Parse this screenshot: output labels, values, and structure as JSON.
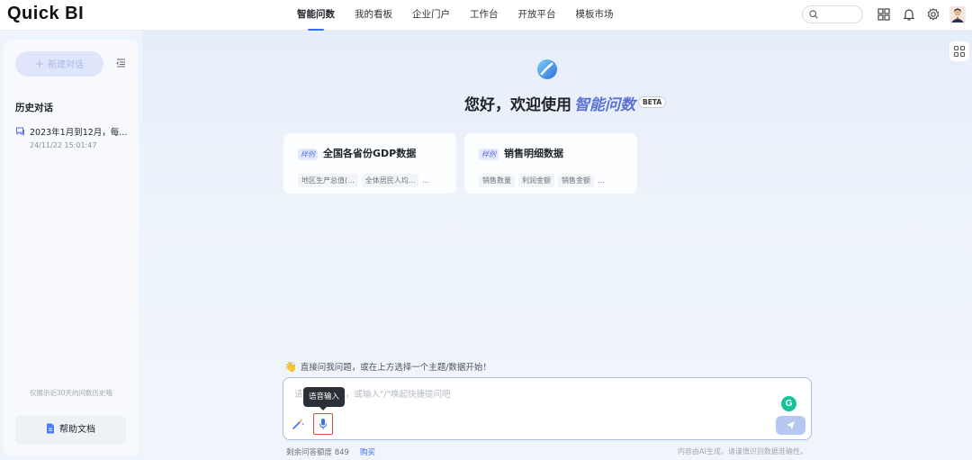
{
  "app": {
    "logo": "Quick BI"
  },
  "nav": {
    "items": [
      {
        "label": "智能问数",
        "active": true
      },
      {
        "label": "我的看板"
      },
      {
        "label": "企业门户"
      },
      {
        "label": "工作台"
      },
      {
        "label": "开放平台"
      },
      {
        "label": "模板市场"
      }
    ]
  },
  "topbar": {
    "icons": [
      "search-icon",
      "grid-apps-icon",
      "bell-icon",
      "settings-gear-icon",
      "avatar"
    ]
  },
  "sidebar": {
    "new_chat_label": "新建对话",
    "history_title": "历史对话",
    "history": [
      {
        "title": "2023年1月到12月，每...",
        "time": "24/11/22 15:01:47"
      }
    ],
    "history_note": "仅展示近30天的问数历史哦",
    "help_label": "帮助文档"
  },
  "hero": {
    "greeting": "您好，欢迎使用",
    "brand": "智能问数",
    "badge": "BETA"
  },
  "cards": [
    {
      "tag": "样例",
      "title": "全国各省份GDP数据",
      "chips": [
        "地区生产总值(...",
        "全体居民人均..."
      ],
      "more": "..."
    },
    {
      "tag": "样例",
      "title": "销售明细数据",
      "chips": [
        "销售数量",
        "利润金额",
        "销售金额"
      ],
      "more": "..."
    }
  ],
  "composer": {
    "suggestion": "直接问我问题，或在上方选择一个主题/数据开始！",
    "placeholder": "请　　　　问，或输入\"/\"唤起快捷提问吧",
    "tooltip": "语音输入",
    "grammarly": "G",
    "quota_label": "剩余问答额度 849",
    "buy_label": "购买",
    "disclaimer": "内容由AI生成，请谨慎识别数据准确性。"
  },
  "colors": {
    "accent": "#3d6ef6",
    "brand_text": "#5a72d6",
    "send_button": "#b4c8f2",
    "highlight_border": "#e0463e"
  }
}
